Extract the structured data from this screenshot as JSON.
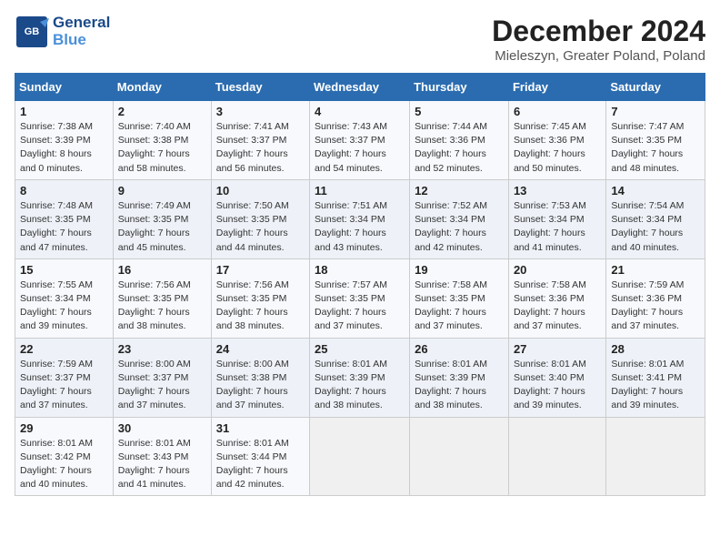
{
  "logo": {
    "general": "General",
    "blue": "Blue"
  },
  "title": "December 2024",
  "subtitle": "Mieleszyn, Greater Poland, Poland",
  "days_header": [
    "Sunday",
    "Monday",
    "Tuesday",
    "Wednesday",
    "Thursday",
    "Friday",
    "Saturday"
  ],
  "weeks": [
    [
      {
        "day": "1",
        "sunrise": "Sunrise: 7:38 AM",
        "sunset": "Sunset: 3:39 PM",
        "daylight": "Daylight: 8 hours and 0 minutes."
      },
      {
        "day": "2",
        "sunrise": "Sunrise: 7:40 AM",
        "sunset": "Sunset: 3:38 PM",
        "daylight": "Daylight: 7 hours and 58 minutes."
      },
      {
        "day": "3",
        "sunrise": "Sunrise: 7:41 AM",
        "sunset": "Sunset: 3:37 PM",
        "daylight": "Daylight: 7 hours and 56 minutes."
      },
      {
        "day": "4",
        "sunrise": "Sunrise: 7:43 AM",
        "sunset": "Sunset: 3:37 PM",
        "daylight": "Daylight: 7 hours and 54 minutes."
      },
      {
        "day": "5",
        "sunrise": "Sunrise: 7:44 AM",
        "sunset": "Sunset: 3:36 PM",
        "daylight": "Daylight: 7 hours and 52 minutes."
      },
      {
        "day": "6",
        "sunrise": "Sunrise: 7:45 AM",
        "sunset": "Sunset: 3:36 PM",
        "daylight": "Daylight: 7 hours and 50 minutes."
      },
      {
        "day": "7",
        "sunrise": "Sunrise: 7:47 AM",
        "sunset": "Sunset: 3:35 PM",
        "daylight": "Daylight: 7 hours and 48 minutes."
      }
    ],
    [
      {
        "day": "8",
        "sunrise": "Sunrise: 7:48 AM",
        "sunset": "Sunset: 3:35 PM",
        "daylight": "Daylight: 7 hours and 47 minutes."
      },
      {
        "day": "9",
        "sunrise": "Sunrise: 7:49 AM",
        "sunset": "Sunset: 3:35 PM",
        "daylight": "Daylight: 7 hours and 45 minutes."
      },
      {
        "day": "10",
        "sunrise": "Sunrise: 7:50 AM",
        "sunset": "Sunset: 3:35 PM",
        "daylight": "Daylight: 7 hours and 44 minutes."
      },
      {
        "day": "11",
        "sunrise": "Sunrise: 7:51 AM",
        "sunset": "Sunset: 3:34 PM",
        "daylight": "Daylight: 7 hours and 43 minutes."
      },
      {
        "day": "12",
        "sunrise": "Sunrise: 7:52 AM",
        "sunset": "Sunset: 3:34 PM",
        "daylight": "Daylight: 7 hours and 42 minutes."
      },
      {
        "day": "13",
        "sunrise": "Sunrise: 7:53 AM",
        "sunset": "Sunset: 3:34 PM",
        "daylight": "Daylight: 7 hours and 41 minutes."
      },
      {
        "day": "14",
        "sunrise": "Sunrise: 7:54 AM",
        "sunset": "Sunset: 3:34 PM",
        "daylight": "Daylight: 7 hours and 40 minutes."
      }
    ],
    [
      {
        "day": "15",
        "sunrise": "Sunrise: 7:55 AM",
        "sunset": "Sunset: 3:34 PM",
        "daylight": "Daylight: 7 hours and 39 minutes."
      },
      {
        "day": "16",
        "sunrise": "Sunrise: 7:56 AM",
        "sunset": "Sunset: 3:35 PM",
        "daylight": "Daylight: 7 hours and 38 minutes."
      },
      {
        "day": "17",
        "sunrise": "Sunrise: 7:56 AM",
        "sunset": "Sunset: 3:35 PM",
        "daylight": "Daylight: 7 hours and 38 minutes."
      },
      {
        "day": "18",
        "sunrise": "Sunrise: 7:57 AM",
        "sunset": "Sunset: 3:35 PM",
        "daylight": "Daylight: 7 hours and 37 minutes."
      },
      {
        "day": "19",
        "sunrise": "Sunrise: 7:58 AM",
        "sunset": "Sunset: 3:35 PM",
        "daylight": "Daylight: 7 hours and 37 minutes."
      },
      {
        "day": "20",
        "sunrise": "Sunrise: 7:58 AM",
        "sunset": "Sunset: 3:36 PM",
        "daylight": "Daylight: 7 hours and 37 minutes."
      },
      {
        "day": "21",
        "sunrise": "Sunrise: 7:59 AM",
        "sunset": "Sunset: 3:36 PM",
        "daylight": "Daylight: 7 hours and 37 minutes."
      }
    ],
    [
      {
        "day": "22",
        "sunrise": "Sunrise: 7:59 AM",
        "sunset": "Sunset: 3:37 PM",
        "daylight": "Daylight: 7 hours and 37 minutes."
      },
      {
        "day": "23",
        "sunrise": "Sunrise: 8:00 AM",
        "sunset": "Sunset: 3:37 PM",
        "daylight": "Daylight: 7 hours and 37 minutes."
      },
      {
        "day": "24",
        "sunrise": "Sunrise: 8:00 AM",
        "sunset": "Sunset: 3:38 PM",
        "daylight": "Daylight: 7 hours and 37 minutes."
      },
      {
        "day": "25",
        "sunrise": "Sunrise: 8:01 AM",
        "sunset": "Sunset: 3:39 PM",
        "daylight": "Daylight: 7 hours and 38 minutes."
      },
      {
        "day": "26",
        "sunrise": "Sunrise: 8:01 AM",
        "sunset": "Sunset: 3:39 PM",
        "daylight": "Daylight: 7 hours and 38 minutes."
      },
      {
        "day": "27",
        "sunrise": "Sunrise: 8:01 AM",
        "sunset": "Sunset: 3:40 PM",
        "daylight": "Daylight: 7 hours and 39 minutes."
      },
      {
        "day": "28",
        "sunrise": "Sunrise: 8:01 AM",
        "sunset": "Sunset: 3:41 PM",
        "daylight": "Daylight: 7 hours and 39 minutes."
      }
    ],
    [
      {
        "day": "29",
        "sunrise": "Sunrise: 8:01 AM",
        "sunset": "Sunset: 3:42 PM",
        "daylight": "Daylight: 7 hours and 40 minutes."
      },
      {
        "day": "30",
        "sunrise": "Sunrise: 8:01 AM",
        "sunset": "Sunset: 3:43 PM",
        "daylight": "Daylight: 7 hours and 41 minutes."
      },
      {
        "day": "31",
        "sunrise": "Sunrise: 8:01 AM",
        "sunset": "Sunset: 3:44 PM",
        "daylight": "Daylight: 7 hours and 42 minutes."
      },
      null,
      null,
      null,
      null
    ]
  ]
}
